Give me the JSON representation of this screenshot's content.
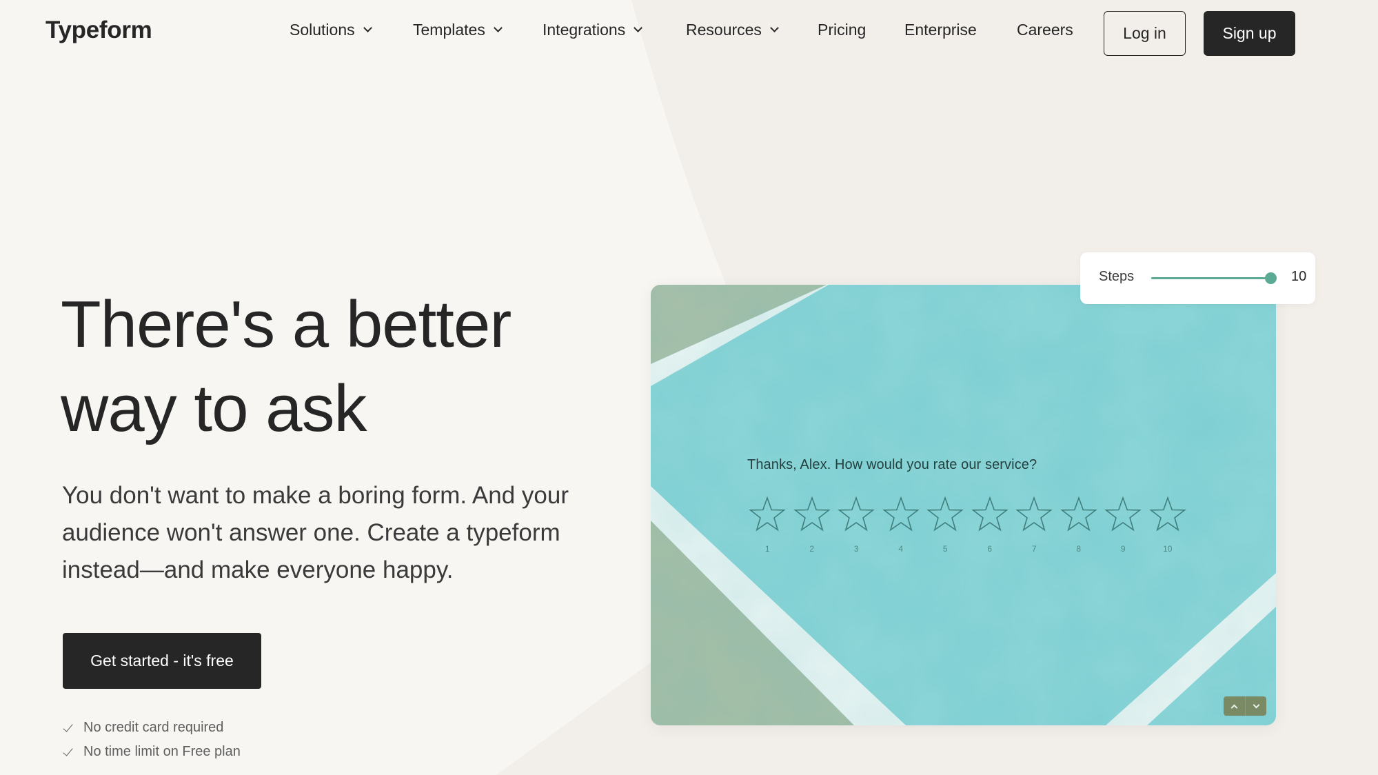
{
  "colors": {
    "background_light": "#f7f6f2",
    "background_warm": "#f2eee9",
    "text_primary": "#262627",
    "button_dark": "#262627",
    "card_teal": "#86d3d5",
    "card_sage": "#a9bfa6",
    "card_stripe": "#e8f5f3",
    "slider_accent": "#5aaa94",
    "arrow_buttons": "#7a8a64"
  },
  "header": {
    "logo": "Typeform",
    "nav": [
      {
        "label": "Solutions",
        "dropdown": true
      },
      {
        "label": "Templates",
        "dropdown": true
      },
      {
        "label": "Integrations",
        "dropdown": true
      },
      {
        "label": "Resources",
        "dropdown": true
      },
      {
        "label": "Pricing",
        "dropdown": false
      },
      {
        "label": "Enterprise",
        "dropdown": false
      },
      {
        "label": "Careers",
        "dropdown": false
      }
    ],
    "login_label": "Log in",
    "signup_label": "Sign up"
  },
  "hero": {
    "title_line1": "There's a better",
    "title_line2": "way to ask",
    "subtitle": "You don't want to make a boring form. And your audience won't answer one. Create a typeform instead—and make everyone happy.",
    "cta_label": "Get started - it's free",
    "checks": [
      {
        "icon": "checkmark-icon",
        "text": "No credit card required"
      },
      {
        "icon": "checkmark-icon",
        "text": "No time limit on Free plan"
      }
    ]
  },
  "preview": {
    "question": "Thanks, Alex. How would you rate our service?",
    "rating_scale": [
      "1",
      "2",
      "3",
      "4",
      "5",
      "6",
      "7",
      "8",
      "9",
      "10"
    ],
    "rating_icon": "star-outline-icon",
    "nav_up_icon": "chevron-up-icon",
    "nav_down_icon": "chevron-down-icon"
  },
  "steps": {
    "label": "Steps",
    "value": "10",
    "slider_fraction": 1.0
  }
}
